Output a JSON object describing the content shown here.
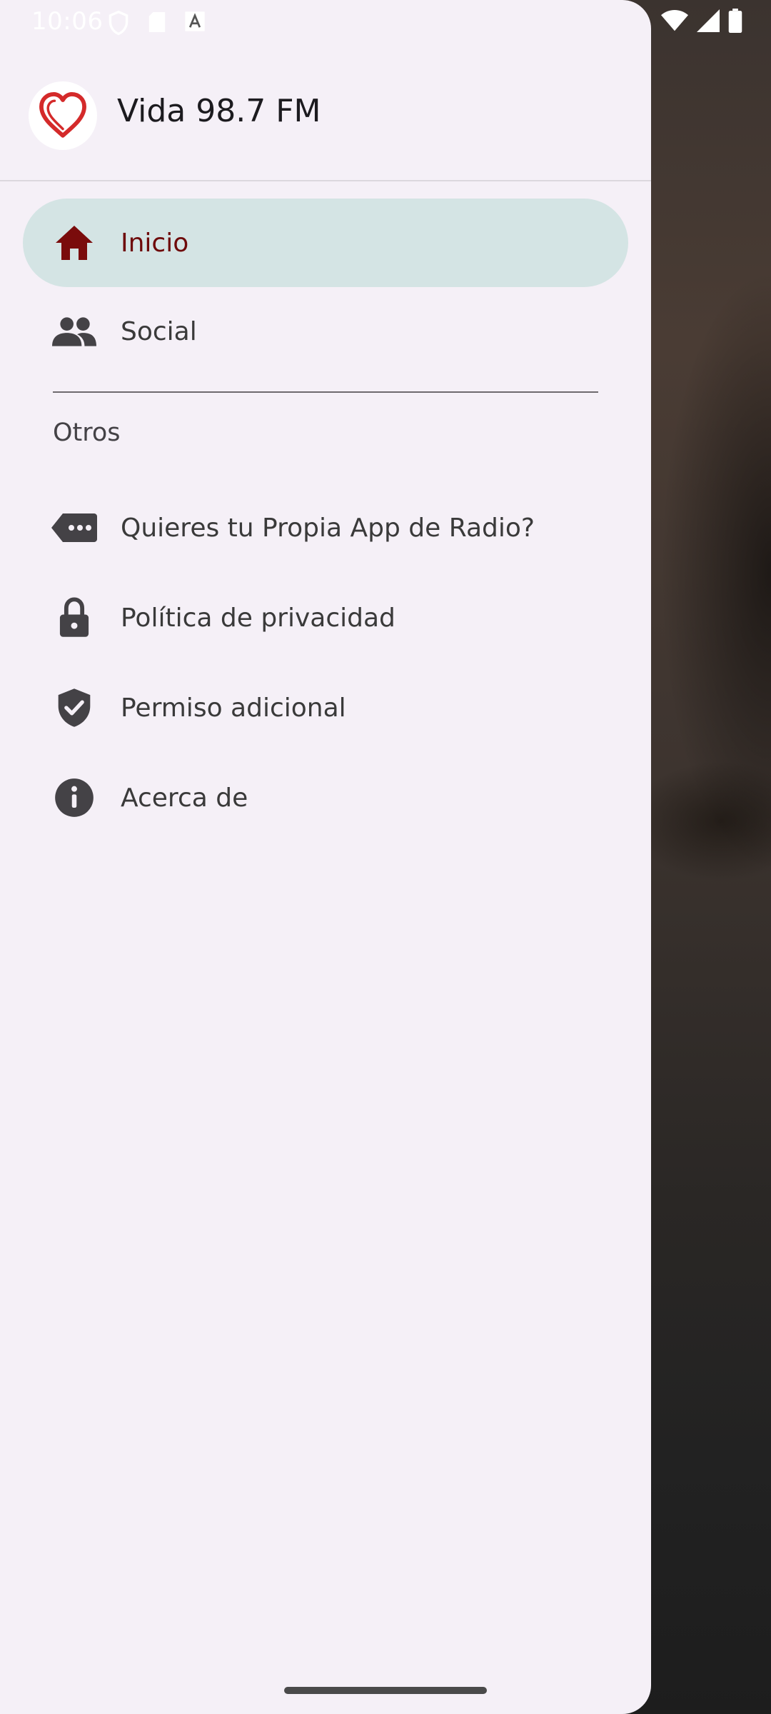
{
  "status_bar": {
    "time": "10:06",
    "left_icons": [
      "shield-icon",
      "sd-card-icon",
      "font-icon"
    ],
    "right_icons": [
      "wifi-icon",
      "signal-icon",
      "battery-icon"
    ]
  },
  "drawer": {
    "app_title": "Vida 98.7 FM",
    "logo_icon": "heart-logo",
    "items": [
      {
        "label": "Inicio",
        "icon": "home-icon",
        "active": true
      },
      {
        "label": "Social",
        "icon": "people-icon",
        "active": false
      }
    ],
    "section_header": "Otros",
    "other_items": [
      {
        "label": "Quieres tu Propia App de Radio?",
        "icon": "tag-dots-icon"
      },
      {
        "label": "Política de privacidad",
        "icon": "lock-icon"
      },
      {
        "label": "Permiso adicional",
        "icon": "verified-shield-icon"
      },
      {
        "label": "Acerca de",
        "icon": "info-icon"
      }
    ]
  },
  "colors": {
    "drawer_background": "#f5f0f7",
    "active_item_background": "#d4e4e4",
    "active_item_color": "#6e0a0a",
    "icon_color": "#444246",
    "logo_red": "#d42a2a"
  }
}
